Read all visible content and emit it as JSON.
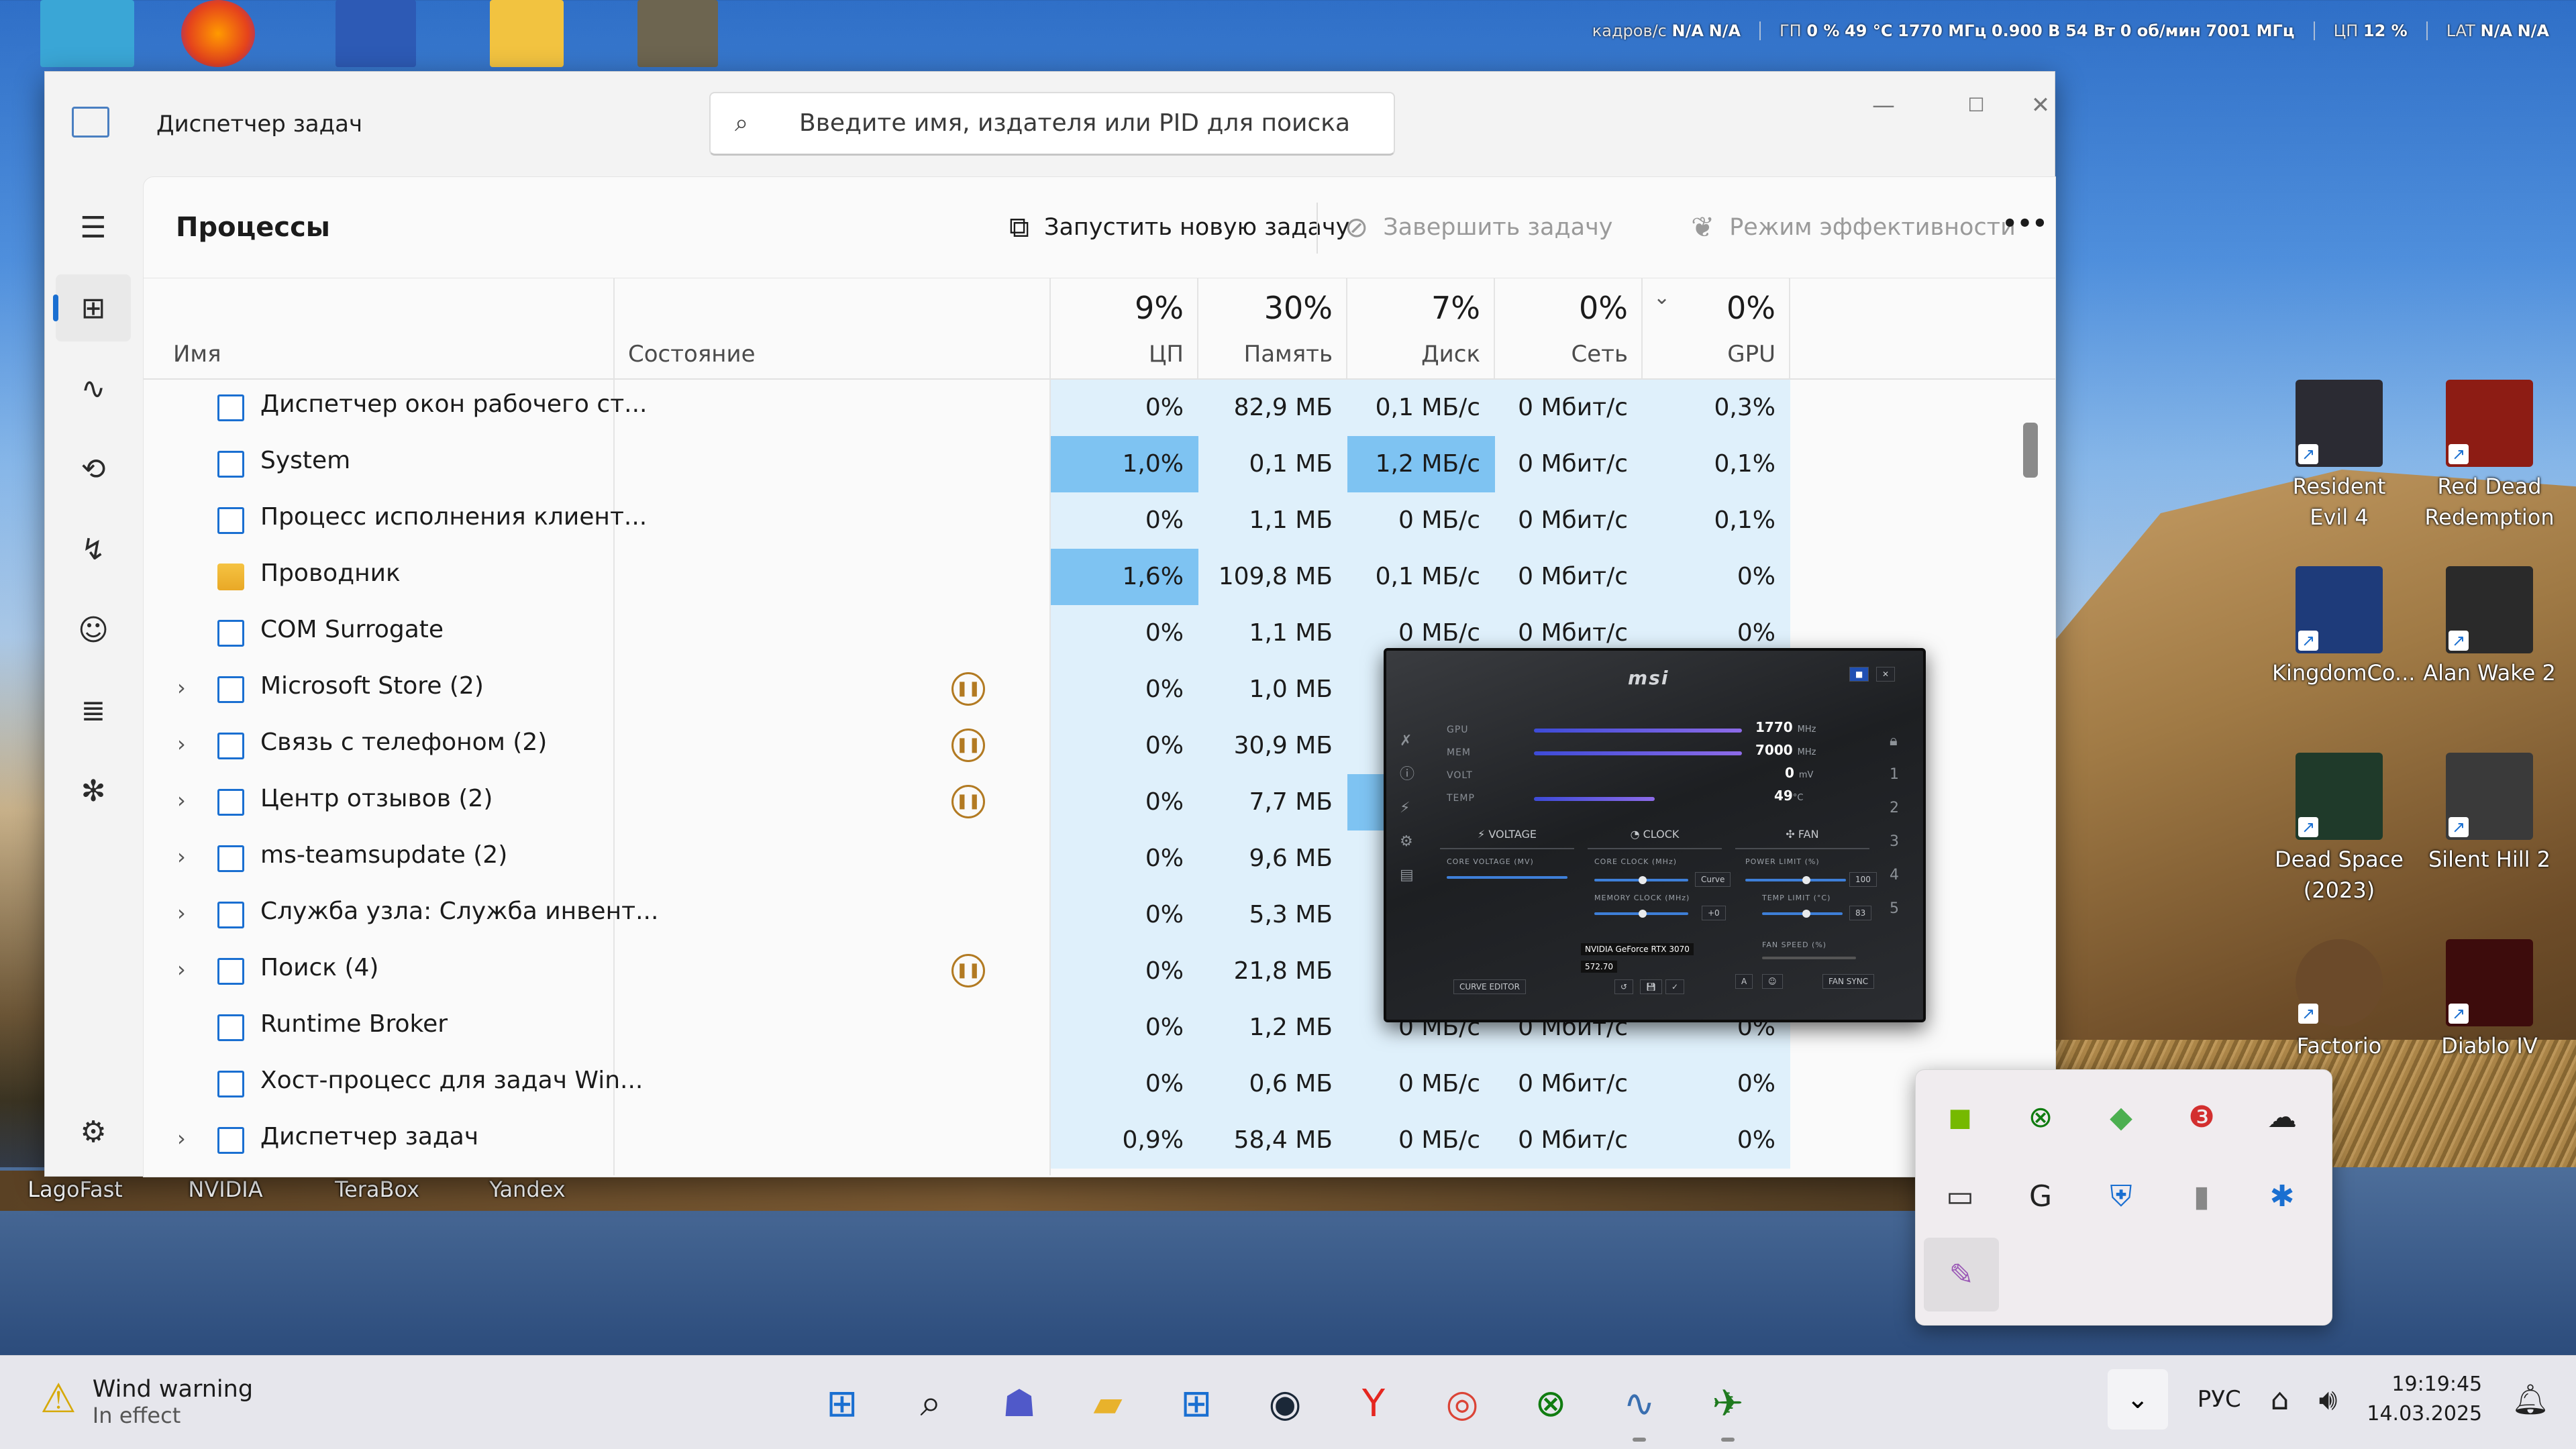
{
  "osd": {
    "fps_label": "кадров/с",
    "fps_val1": "N/A",
    "fps_val2": "N/A",
    "gpu_label": "ГП",
    "gpu_load": "0 %",
    "gpu_temp": "49 °C",
    "gpu_clock": "1770 МГц",
    "gpu_volt": "0.900 В",
    "gpu_power": "54 Вт",
    "gpu_fan": "0 об/мин",
    "gpu_mem": "7001 МГц",
    "cpu_label": "ЦП",
    "cpu_load": "12 %",
    "lat_label": "LAT",
    "lat_val1": "N/A",
    "lat_val2": "N/A"
  },
  "desktop_icons": [
    {
      "label": "Resident Evil 4",
      "color": "#2b2b33"
    },
    {
      "label": "Red Dead Redemption",
      "color": "#8d1c14"
    },
    {
      "label": "KingdomCo...",
      "color": "#1e3b7a"
    },
    {
      "label": "Alan Wake 2",
      "color": "#2a2a2a"
    },
    {
      "label": "Dead Space (2023)",
      "color": "#1f3a2a"
    },
    {
      "label": "Silent Hill 2",
      "color": "#3a3a3a"
    },
    {
      "label": "Factorio",
      "color": "#6b4a2a"
    },
    {
      "label": "Diablo IV",
      "color": "#3d0c0c"
    },
    {
      "label": "LagoFast",
      "color": "#1b4bd8"
    },
    {
      "label": "NVIDIA",
      "color": "#111"
    },
    {
      "label": "TeraBox",
      "color": "#e9e9ef"
    },
    {
      "label": "Yandex",
      "color": "#f0f0f0"
    }
  ],
  "window": {
    "app_title": "Диспетчер задач",
    "search_placeholder": "Введите имя, издателя или PID для поиска",
    "minimize": "—",
    "maximize": "☐",
    "close": "✕"
  },
  "nav": {
    "menu_icon": "☰",
    "processes_icon": "⊞",
    "performance_icon": "∿",
    "history_icon": "⟲",
    "startup_icon": "↯",
    "users_icon": "☺",
    "details_icon": "≣",
    "services_icon": "✻",
    "settings_icon": "⚙"
  },
  "toolbar": {
    "page_title": "Процессы",
    "run_new_task": "Запустить новую задачу",
    "end_task": "Завершить задачу",
    "efficiency_mode": "Режим эффективности",
    "more": "•••"
  },
  "columns": {
    "name": "Имя",
    "status": "Состояние",
    "cpu_pct": "9%",
    "cpu": "ЦП",
    "mem_pct": "30%",
    "mem": "Память",
    "disk_pct": "7%",
    "disk": "Диск",
    "net_pct": "0%",
    "net": "Сеть",
    "gpu_pct": "0%",
    "gpu": "GPU"
  },
  "processes": [
    {
      "name": "Диспетчер окон рабочего ст...",
      "expand": false,
      "suspended": false,
      "icon": "app",
      "cpu": "0%",
      "mem": "82,9 МБ",
      "disk": "0,1 МБ/с",
      "net": "0 Мбит/с",
      "gpu": "0,3%"
    },
    {
      "name": "System",
      "expand": false,
      "suspended": false,
      "icon": "app",
      "cpu": "1,0%",
      "mem": "0,1 МБ",
      "disk": "1,2 МБ/с",
      "net": "0 Мбит/с",
      "gpu": "0,1%"
    },
    {
      "name": "Процесс исполнения клиент...",
      "expand": false,
      "suspended": false,
      "icon": "app",
      "cpu": "0%",
      "mem": "1,1 МБ",
      "disk": "0 МБ/с",
      "net": "0 Мбит/с",
      "gpu": "0,1%"
    },
    {
      "name": "Проводник",
      "expand": false,
      "suspended": false,
      "icon": "folder",
      "cpu": "1,6%",
      "mem": "109,8 МБ",
      "disk": "0,1 МБ/с",
      "net": "0 Мбит/с",
      "gpu": "0%"
    },
    {
      "name": "COM Surrogate",
      "expand": false,
      "suspended": false,
      "icon": "app",
      "cpu": "0%",
      "mem": "1,1 МБ",
      "disk": "0 МБ/с",
      "net": "0 Мбит/с",
      "gpu": "0%"
    },
    {
      "name": "Microsoft Store (2)",
      "expand": true,
      "suspended": true,
      "icon": "app",
      "cpu": "0%",
      "mem": "1,0 МБ",
      "disk": "0 М",
      "net": "",
      "gpu": ""
    },
    {
      "name": "Связь с телефоном (2)",
      "expand": true,
      "suspended": true,
      "icon": "app",
      "cpu": "0%",
      "mem": "30,9 МБ",
      "disk": "0 М",
      "net": "",
      "gpu": ""
    },
    {
      "name": "Центр отзывов (2)",
      "expand": true,
      "suspended": true,
      "icon": "app",
      "cpu": "0%",
      "mem": "7,7 МБ",
      "disk": "11,2 М",
      "net": "",
      "gpu": ""
    },
    {
      "name": "ms-teamsupdate (2)",
      "expand": true,
      "suspended": false,
      "icon": "app",
      "cpu": "0%",
      "mem": "9,6 МБ",
      "disk": "0 М",
      "net": "",
      "gpu": ""
    },
    {
      "name": "Служба узла: Служба инвент...",
      "expand": true,
      "suspended": false,
      "icon": "app",
      "cpu": "0%",
      "mem": "5,3 МБ",
      "disk": "0 М",
      "net": "",
      "gpu": ""
    },
    {
      "name": "Поиск (4)",
      "expand": true,
      "suspended": true,
      "icon": "app",
      "cpu": "0%",
      "mem": "21,8 МБ",
      "disk": "0 М",
      "net": "",
      "gpu": ""
    },
    {
      "name": "Runtime Broker",
      "expand": false,
      "suspended": false,
      "icon": "app",
      "cpu": "0%",
      "mem": "1,2 МБ",
      "disk": "0 МБ/с",
      "net": "0 Мбит/с",
      "gpu": "0%"
    },
    {
      "name": "Хост-процесс для задач Win...",
      "expand": false,
      "suspended": false,
      "icon": "app",
      "cpu": "0%",
      "mem": "0,6 МБ",
      "disk": "0 МБ/с",
      "net": "0 Мбит/с",
      "gpu": "0%"
    },
    {
      "name": "Диспетчер задач",
      "expand": true,
      "suspended": false,
      "icon": "app",
      "cpu": "0,9%",
      "mem": "58,4 МБ",
      "disk": "0 МБ/с",
      "net": "0 Мбит/с",
      "gpu": "0%"
    }
  ],
  "msi": {
    "logo": "msi",
    "gpu_label": "GPU",
    "gpu_value": "1770",
    "gpu_unit": "MHz",
    "mem_label": "MEM",
    "mem_value": "7000",
    "mem_unit": "MHz",
    "volt_label": "VOLT",
    "volt_value": "0",
    "volt_unit": "mV",
    "temp_label": "TEMP",
    "temp_value": "49",
    "temp_unit": "°C",
    "tab_voltage": "VOLTAGE",
    "tab_clock": "CLOCK",
    "tab_fan": "FAN",
    "core_voltage": "CORE VOLTAGE (MV)",
    "core_clock": "CORE CLOCK (MHz)",
    "memory_clock": "MEMORY CLOCK (MHz)",
    "power_limit": "POWER LIMIT (%)",
    "temp_limit": "TEMP LIMIT (°C)",
    "fan_speed": "FAN SPEED (%)",
    "curve": "Curve",
    "core_clock_offset": "+0",
    "power_value": "100",
    "temp_value_limit": "83",
    "gpu_name": "NVIDIA GeForce RTX 3070",
    "driver": "572.70",
    "curve_editor": "CURVE EDITOR",
    "fan_sync": "FAN SYNC"
  },
  "tray_icons": [
    {
      "name": "nvidia-icon",
      "glyph": "◼",
      "color": "#76b900"
    },
    {
      "name": "xbox-icon",
      "glyph": "⊗",
      "color": "#107c10"
    },
    {
      "name": "game-icon",
      "glyph": "◆",
      "color": "#4caf50"
    },
    {
      "name": "steelseries-icon",
      "glyph": "❸",
      "color": "#d32f2f"
    },
    {
      "name": "cloud-off-icon",
      "glyph": "☁",
      "color": "#222"
    },
    {
      "name": "monitor-icon",
      "glyph": "▭",
      "color": "#333"
    },
    {
      "name": "ghub-icon",
      "glyph": "G",
      "color": "#222"
    },
    {
      "name": "defender-icon",
      "glyph": "⛨",
      "color": "#1a6fd1"
    },
    {
      "name": "app-icon",
      "glyph": "▮",
      "color": "#888"
    },
    {
      "name": "bluetooth-icon",
      "glyph": "✱",
      "color": "#1a6fd1"
    },
    {
      "name": "feather-icon",
      "glyph": "✎",
      "color": "#9b59b6"
    }
  ],
  "taskbar": {
    "weather_title": "Wind warning",
    "weather_sub": "In effect",
    "lang": "РУС",
    "time": "19:19:45",
    "date": "14.03.2025"
  }
}
